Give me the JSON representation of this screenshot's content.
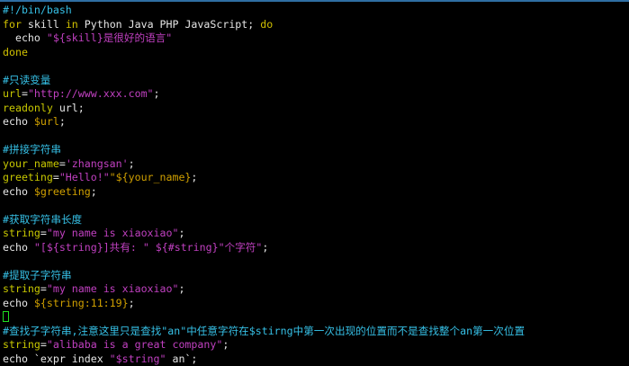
{
  "colors": {
    "background": "#000000",
    "comment": "#36c0e6",
    "keyword": "#d0c000",
    "plain": "#e6e6e6",
    "string": "#c040c0",
    "variable": "#d0a000",
    "ident": "#c8c800",
    "cursor": "#20e020",
    "topbar": "#2f6fa3"
  },
  "terminal": {
    "lines": [
      [
        {
          "t": "comment",
          "v": "#!/bin/bash"
        }
      ],
      [
        {
          "t": "keyword",
          "v": "for"
        },
        {
          "t": "plain",
          "v": " skill "
        },
        {
          "t": "keyword",
          "v": "in"
        },
        {
          "t": "plain",
          "v": " Python Java PHP JavaScript; "
        },
        {
          "t": "keyword",
          "v": "do"
        }
      ],
      [
        {
          "t": "plain",
          "v": "  echo "
        },
        {
          "t": "string",
          "v": "\"${skill}是很好的语言\""
        }
      ],
      [
        {
          "t": "keyword",
          "v": "done"
        }
      ],
      [],
      [
        {
          "t": "comment",
          "v": "#只读变量"
        }
      ],
      [
        {
          "t": "ident",
          "v": "url"
        },
        {
          "t": "plain",
          "v": "="
        },
        {
          "t": "string",
          "v": "\"http://www.xxx.com\""
        },
        {
          "t": "plain",
          "v": ";"
        }
      ],
      [
        {
          "t": "ident",
          "v": "readonly"
        },
        {
          "t": "plain",
          "v": " url;"
        }
      ],
      [
        {
          "t": "plain",
          "v": "echo "
        },
        {
          "t": "variable",
          "v": "$url"
        },
        {
          "t": "plain",
          "v": ";"
        }
      ],
      [],
      [
        {
          "t": "comment",
          "v": "#拼接字符串"
        }
      ],
      [
        {
          "t": "ident",
          "v": "your_name"
        },
        {
          "t": "plain",
          "v": "="
        },
        {
          "t": "string",
          "v": "'zhangsan'"
        },
        {
          "t": "plain",
          "v": ";"
        }
      ],
      [
        {
          "t": "ident",
          "v": "greeting"
        },
        {
          "t": "plain",
          "v": "="
        },
        {
          "t": "string",
          "v": "\"Hello!\""
        },
        {
          "t": "variable",
          "v": "\"${your_name}"
        },
        {
          "t": "plain",
          "v": ";"
        }
      ],
      [
        {
          "t": "plain",
          "v": "echo "
        },
        {
          "t": "variable",
          "v": "$greeting"
        },
        {
          "t": "plain",
          "v": ";"
        }
      ],
      [],
      [
        {
          "t": "comment",
          "v": "#获取字符串长度"
        }
      ],
      [
        {
          "t": "ident",
          "v": "string"
        },
        {
          "t": "plain",
          "v": "="
        },
        {
          "t": "string",
          "v": "\"my name is xiaoxiao\""
        },
        {
          "t": "plain",
          "v": ";"
        }
      ],
      [
        {
          "t": "plain",
          "v": "echo "
        },
        {
          "t": "string",
          "v": "\"[${string}]共有: \" ${#string}\"个字符\""
        },
        {
          "t": "plain",
          "v": ";"
        }
      ],
      [],
      [
        {
          "t": "comment",
          "v": "#提取子字符串"
        }
      ],
      [
        {
          "t": "ident",
          "v": "string"
        },
        {
          "t": "plain",
          "v": "="
        },
        {
          "t": "string",
          "v": "\"my name is xiaoxiao\""
        },
        {
          "t": "plain",
          "v": ";"
        }
      ],
      [
        {
          "t": "plain",
          "v": "echo "
        },
        {
          "t": "variable",
          "v": "${string:11:19}"
        },
        {
          "t": "plain",
          "v": ";"
        }
      ],
      [
        {
          "t": "cursor",
          "v": ""
        }
      ],
      [
        {
          "t": "comment",
          "v": "#查找子字符串,注意这里只是查找\"an\"中任意字符在$stirng中第一次出现的位置而不是查找整个an第一次位置"
        }
      ],
      [
        {
          "t": "ident",
          "v": "string"
        },
        {
          "t": "plain",
          "v": "="
        },
        {
          "t": "string",
          "v": "\"alibaba is a great company\""
        },
        {
          "t": "plain",
          "v": ";"
        }
      ],
      [
        {
          "t": "plain",
          "v": "echo `expr index "
        },
        {
          "t": "string",
          "v": "\"$string\""
        },
        {
          "t": "plain",
          "v": " an`;"
        }
      ]
    ]
  }
}
